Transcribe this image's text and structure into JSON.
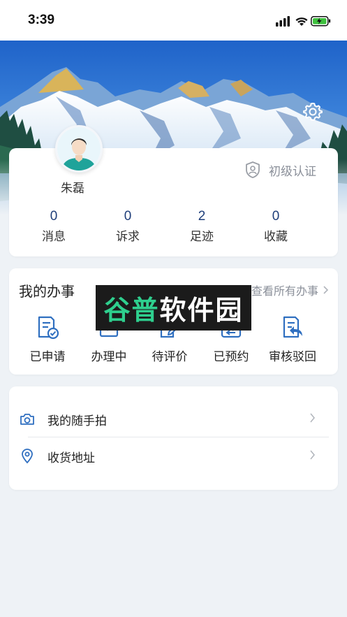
{
  "status_bar": {
    "time": "3:39"
  },
  "profile": {
    "name": "朱磊",
    "certification": "初级认证",
    "stats": [
      {
        "value": "0",
        "label": "消息"
      },
      {
        "value": "0",
        "label": "诉求"
      },
      {
        "value": "2",
        "label": "足迹"
      },
      {
        "value": "0",
        "label": "收藏"
      }
    ]
  },
  "tasks": {
    "title": "我的办事",
    "view_all": "查看所有办事",
    "items": [
      {
        "label": "已申请",
        "icon": "applied-doc-icon"
      },
      {
        "label": "办理中",
        "icon": "processing-icon"
      },
      {
        "label": "待评价",
        "icon": "to-review-icon"
      },
      {
        "label": "已预约",
        "icon": "reserved-icon"
      },
      {
        "label": "审核驳回",
        "icon": "rejected-icon"
      }
    ]
  },
  "watermark": {
    "part1": "谷普",
    "part2": "软件园"
  },
  "menu": {
    "items": [
      {
        "label": "我的随手拍",
        "icon": "camera-icon"
      },
      {
        "label": "收货地址",
        "icon": "location-pin-icon"
      }
    ]
  },
  "colors": {
    "accent": "#2f6fc0",
    "stat_value": "#1f3f7a",
    "page_bg": "#eef2f6"
  }
}
